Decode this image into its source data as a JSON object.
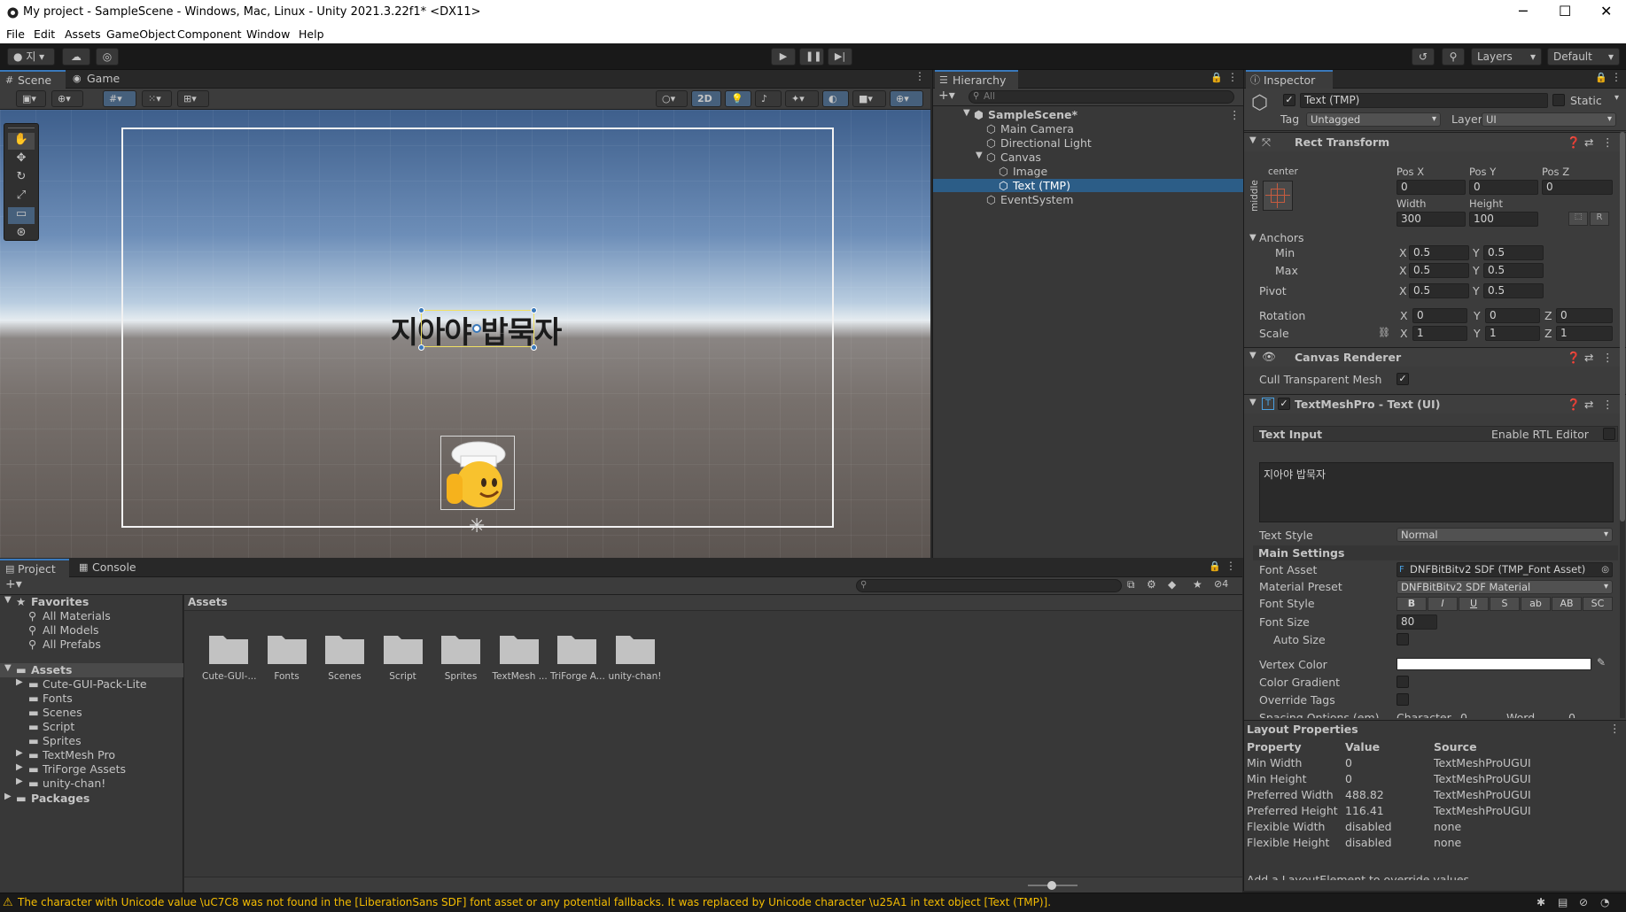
{
  "window": {
    "title": "My project - SampleScene - Windows, Mac, Linux - Unity 2021.3.22f1* <DX11>"
  },
  "menu": [
    "File",
    "Edit",
    "Assets",
    "GameObject",
    "Component",
    "Window",
    "Help"
  ],
  "toolbar": {
    "account": "지",
    "layers": "Layers",
    "layout": "Default"
  },
  "scene_tabs": {
    "scene": "Scene",
    "game": "Game"
  },
  "scene_toolbar": {
    "mode_2d": "2D"
  },
  "scene_view": {
    "canvas_text": "지아야 밥묵자"
  },
  "hierarchy": {
    "tab": "Hierarchy",
    "search_placeholder": "All",
    "items": [
      "SampleScene*",
      "Main Camera",
      "Directional Light",
      "Canvas",
      "Image",
      "Text (TMP)",
      "EventSystem"
    ]
  },
  "inspector": {
    "tab": "Inspector",
    "object_name": "Text (TMP)",
    "static_label": "Static",
    "tag_label": "Tag",
    "tag_value": "Untagged",
    "layer_label": "Layer",
    "layer_value": "UI",
    "rect_transform": {
      "title": "Rect Transform",
      "anchor_h": "center",
      "anchor_v": "middle",
      "pos_x_label": "Pos X",
      "pos_y_label": "Pos Y",
      "pos_z_label": "Pos Z",
      "pos_x": "0",
      "pos_y": "0",
      "pos_z": "0",
      "width_label": "Width",
      "height_label": "Height",
      "width": "300",
      "height": "100",
      "r_button": "R",
      "anchors_label": "Anchors",
      "min_label": "Min",
      "max_label": "Max",
      "min_x": "0.5",
      "min_y": "0.5",
      "max_x": "0.5",
      "max_y": "0.5",
      "pivot_label": "Pivot",
      "pivot_x": "0.5",
      "pivot_y": "0.5",
      "rotation_label": "Rotation",
      "rot_x": "0",
      "rot_y": "0",
      "rot_z": "0",
      "scale_label": "Scale",
      "scale_x": "1",
      "scale_y": "1",
      "scale_z": "1",
      "x": "X",
      "y": "Y",
      "z": "Z"
    },
    "canvas_renderer": {
      "title": "Canvas Renderer",
      "cull_label": "Cull Transparent Mesh"
    },
    "tmp": {
      "title": "TextMeshPro - Text (UI)",
      "text_input_label": "Text Input",
      "rtl_label": "Enable RTL Editor",
      "text_value": "지아야 밥묵자",
      "text_style_label": "Text Style",
      "text_style_value": "Normal",
      "main_settings": "Main Settings",
      "font_asset_label": "Font Asset",
      "font_asset_value": "DNFBitBitv2 SDF (TMP_Font Asset)",
      "material_label": "Material Preset",
      "material_value": "DNFBitBitv2 SDF Material",
      "font_style_label": "Font Style",
      "font_style_buttons": [
        "B",
        "I",
        "U",
        "S",
        "ab",
        "AB",
        "SC"
      ],
      "font_size_label": "Font Size",
      "font_size_value": "80",
      "auto_size_label": "Auto Size",
      "vertex_color_label": "Vertex Color",
      "color_gradient_label": "Color Gradient",
      "override_tags_label": "Override Tags",
      "spacing_label": "Spacing Options (em)",
      "character_label": "Character",
      "character_value": "0",
      "word_label": "Word",
      "word_value": "0"
    },
    "layout_properties": {
      "title": "Layout Properties",
      "headers": [
        "Property",
        "Value",
        "Source"
      ],
      "rows": [
        [
          "Min Width",
          "0",
          "TextMeshProUGUI"
        ],
        [
          "Min Height",
          "0",
          "TextMeshProUGUI"
        ],
        [
          "Preferred Width",
          "488.82",
          "TextMeshProUGUI"
        ],
        [
          "Preferred Height",
          "116.41",
          "TextMeshProUGUI"
        ],
        [
          "Flexible Width",
          "disabled",
          "none"
        ],
        [
          "Flexible Height",
          "disabled",
          "none"
        ]
      ],
      "footer": "Add a LayoutElement to override values"
    }
  },
  "project": {
    "tabs": {
      "project": "Project",
      "console": "Console"
    },
    "badge": "4",
    "favorites": {
      "title": "Favorites",
      "items": [
        "All Materials",
        "All Models",
        "All Prefabs"
      ]
    },
    "assets_title": "Assets",
    "tree": [
      "Cute-GUI-Pack-Lite",
      "Fonts",
      "Scenes",
      "Script",
      "Sprites",
      "TextMesh Pro",
      "TriForge Assets",
      "unity-chan!"
    ],
    "packages": "Packages",
    "breadcrumb": "Assets",
    "folders": [
      "Cute-GUI-...",
      "Fonts",
      "Scenes",
      "Script",
      "Sprites",
      "TextMesh ...",
      "TriForge A...",
      "unity-chan!"
    ]
  },
  "status": {
    "message": "The character with Unicode value \\uC7C8 was not found in the [LiberationSans SDF] font asset or any potential fallbacks. It was replaced by Unicode character \\u25A1 in text object [Text (TMP)]."
  },
  "colors": {
    "accent": "#2c5d87",
    "warning": "#f4bc02",
    "selection": "#2c5d87"
  }
}
